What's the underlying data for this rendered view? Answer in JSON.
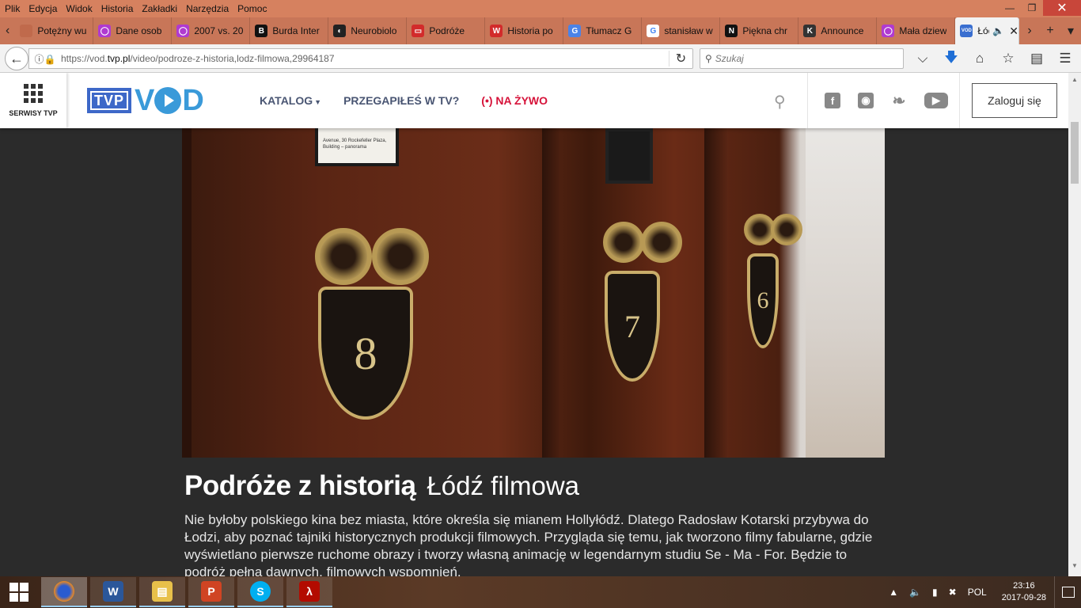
{
  "menu": [
    "Plik",
    "Edycja",
    "Widok",
    "Historia",
    "Zakładki",
    "Narzędzia",
    "Pomoc"
  ],
  "tabs": [
    {
      "title": "Potężny wu",
      "color": "#c06a4c",
      "glyph": ""
    },
    {
      "title": "Dane osob",
      "color": "#b03ad0",
      "glyph": "◯"
    },
    {
      "title": "2007 vs. 20",
      "color": "#b03ad0",
      "glyph": "◯"
    },
    {
      "title": "Burda Inter",
      "color": "#111111",
      "glyph": "B"
    },
    {
      "title": "Neurobiolo",
      "color": "#222222",
      "glyph": "◐"
    },
    {
      "title": "Podróże",
      "color": "#d22b2b",
      "glyph": "▭"
    },
    {
      "title": "Historia po",
      "color": "#d22b2b",
      "glyph": "W"
    },
    {
      "title": "Tłumacz G",
      "color": "#4b83e8",
      "glyph": "G"
    },
    {
      "title": "stanisław w",
      "color": "#ffffff",
      "glyph": "G"
    },
    {
      "title": "Piękna chr",
      "color": "#111111",
      "glyph": "N"
    },
    {
      "title": "Announce",
      "color": "#333333",
      "glyph": "K"
    },
    {
      "title": "Mała dziew",
      "color": "#b03ad0",
      "glyph": "◯"
    }
  ],
  "active_tab": {
    "title": "Łódź",
    "favicon": "VOD"
  },
  "url": {
    "prefix": "https://vod.",
    "domain": "tvp.pl",
    "path": "/video/podroze-z-historia,lodz-filmowa,29964187"
  },
  "search_placeholder": "Szukaj",
  "site": {
    "serwisy_label": "SERWISY TVP",
    "logo_tvp": "TVP",
    "nav": {
      "catalog": "KATALOG",
      "missed": "PRZEGAPIŁEŚ W TV?",
      "live_icon": "(•)",
      "live": "NA ŻYWO"
    },
    "login": "Zaloguj się"
  },
  "hero": {
    "note_text": "Avenue, 30 Rockefeller Plaza, Building – panorama",
    "numbers": [
      "8",
      "7",
      "6"
    ]
  },
  "show": {
    "title": "Podróże z historią",
    "episode": "Łódź filmowa",
    "description": "Nie byłoby polskiego kina bez miasta, które określa się mianem Hollyłódź. Dlatego Radosław Kotarski przybywa do Łodzi, aby poznać tajniki historycznych produkcji filmowych. Przygląda się temu, jak tworzono filmy fabularne, gdzie wyświetlano pierwsze ruchome obrazy i tworzy własną animację w legendarnym studiu Se - Ma - For. Będzie to podróż pełna dawnych, filmowych wspomnień."
  },
  "taskbar": {
    "apps": [
      "firefox-icon",
      "word-icon",
      "file-explorer-icon",
      "powerpoint-icon",
      "skype-icon",
      "acrobat-icon"
    ],
    "lang": "POL",
    "time": "23:16",
    "date": "2017-09-28"
  },
  "colors": {
    "tvp_blue": "#3d68c8",
    "vod_blue": "#3a9ad9",
    "live_red": "#d6133a",
    "nav_text": "#4a5673",
    "page_bg": "#2b2b2b"
  }
}
